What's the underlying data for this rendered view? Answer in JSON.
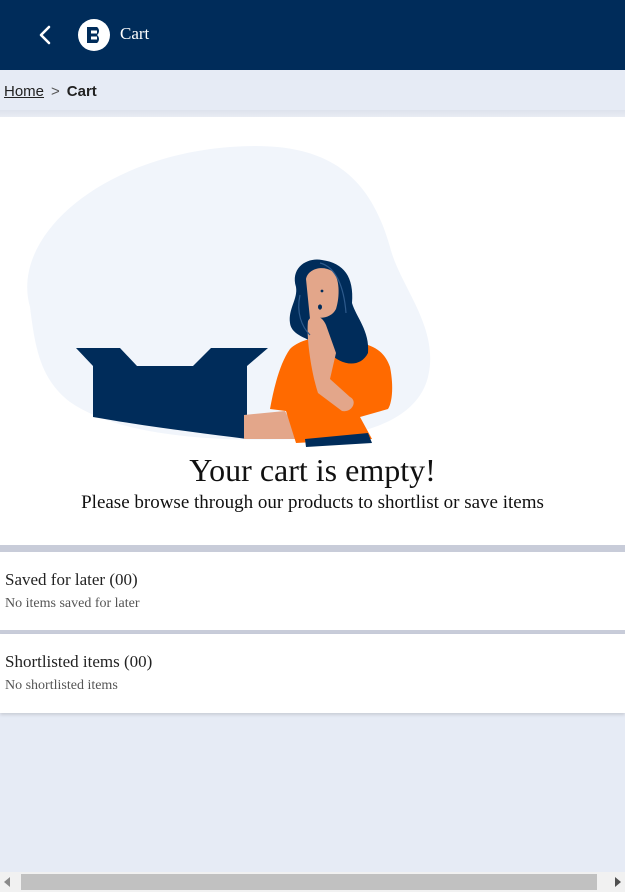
{
  "header": {
    "title": "Cart",
    "back_icon": "chevron-left-icon",
    "logo_icon": "brand-logo-icon",
    "background_color": "#002c5a"
  },
  "breadcrumb": {
    "home": "Home",
    "separator": ">",
    "current": "Cart"
  },
  "empty_cart": {
    "title": "Your cart is empty!",
    "subtitle": "Please browse through our products to shortlist or save items",
    "illustration_icon": "woman-with-empty-box-illustration",
    "accent_color": "#ff6a00"
  },
  "saved_for_later": {
    "title": "Saved for later (00)",
    "message": "No items saved for later"
  },
  "shortlisted": {
    "title": "Shortlisted items (00)",
    "message": "No shortlisted items"
  }
}
